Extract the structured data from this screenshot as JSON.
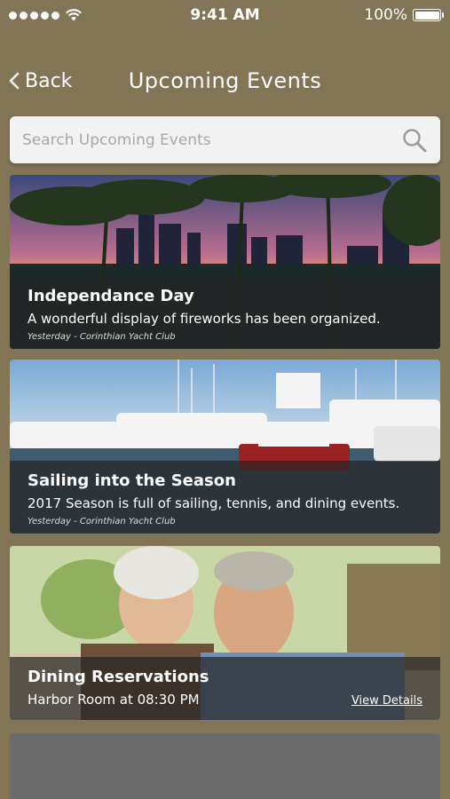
{
  "status_bar": {
    "time": "9:41 AM",
    "battery": "100%",
    "signal_icon": "signal-dots-icon",
    "wifi_icon": "wifi-icon",
    "battery_icon": "battery-icon"
  },
  "nav": {
    "back_label": "Back",
    "back_icon": "chevron-left-icon",
    "title": "Upcoming Events"
  },
  "search": {
    "placeholder": "Search Upcoming Events",
    "value": "",
    "icon": "search-icon"
  },
  "events": [
    {
      "title": "Independance Day",
      "description": "A wonderful display of fireworks has been organized.",
      "meta": "Yesterday - Corinthian Yacht Club",
      "image": "city-skyline-palm-trees-sunset"
    },
    {
      "title": "Sailing into the Season",
      "description": "2017 Season is full of sailing, tennis, and dining events.",
      "meta": "Yesterday - Corinthian Yacht Club",
      "image": "marina-yachts"
    },
    {
      "title": "Dining Reservations",
      "description": "Harbor Room at 08:30 PM",
      "action": "View Details",
      "image": "couple-dining"
    }
  ],
  "colors": {
    "background": "#827556",
    "overlay": "#262626",
    "search_bg": "#f2f2f2"
  }
}
